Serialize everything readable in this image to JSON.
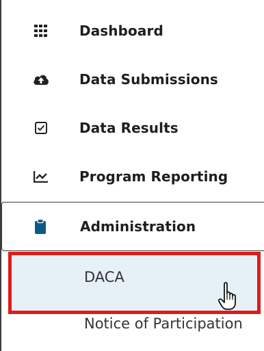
{
  "sidebar": {
    "items": [
      {
        "label": "Dashboard",
        "icon": "dashboard-grid-icon"
      },
      {
        "label": "Data Submissions",
        "icon": "cloud-upload-icon"
      },
      {
        "label": "Data Results",
        "icon": "checkbox-icon"
      },
      {
        "label": "Program Reporting",
        "icon": "line-chart-icon"
      },
      {
        "label": "Administration",
        "icon": "clipboard-icon"
      }
    ],
    "subitems": [
      {
        "label": "DACA"
      },
      {
        "label": "Notice of Participation"
      }
    ]
  },
  "colors": {
    "highlight_border": "#e01a1a",
    "subitem_bg": "#e6f1f7",
    "active_icon": "#0b5a86"
  }
}
